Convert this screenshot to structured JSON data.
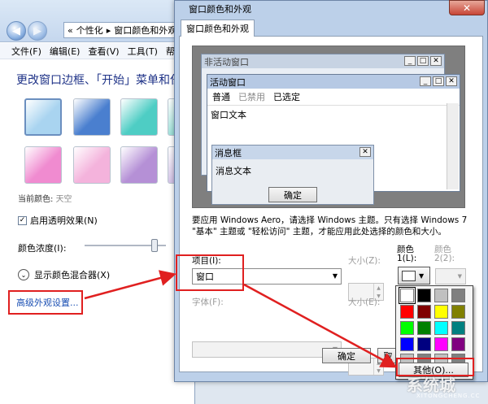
{
  "background_window": {
    "nav": {
      "back": "◀",
      "forward": "▶"
    },
    "address": {
      "prefix": "«",
      "crumb1": "个性化",
      "sep": "▸",
      "crumb2": "窗口颜色和外观"
    },
    "menu": [
      "文件(F)",
      "编辑(E)",
      "查看(V)",
      "工具(T)",
      "帮助"
    ],
    "heading": "更改窗口边框、「开始」菜单和任",
    "swatches": [
      "#a9d4f0",
      "#4a7fcf",
      "#4ecdc4",
      "#9be0d8",
      "#f08bd0",
      "#f4b3dc",
      "#b590d6",
      "#d2c1e6"
    ],
    "current_color_label": "当前颜色:",
    "current_color_value": "天空",
    "transparency_label": "启用透明效果(N)",
    "transparency_check": "✓",
    "intensity_label": "颜色浓度(I):",
    "mixer_label": "显示颜色混合器(X)",
    "mixer_icon": "⌄",
    "advanced_link": "高级外观设置..."
  },
  "dialog": {
    "title": "窗口颜色和外观",
    "close": "✕",
    "tab": "窗口颜色和外观",
    "preview": {
      "inactive_title": "非活动窗口",
      "active_title": "活动窗口",
      "menu_normal": "普通",
      "menu_disabled": "已禁用",
      "menu_selected": "已选定",
      "window_text": "窗口文本",
      "msgbox_title": "消息框",
      "msgbox_text": "消息文本",
      "msgbox_ok": "确定",
      "btn_min": "_",
      "btn_max": "□",
      "btn_close": "✕"
    },
    "description": "要应用 Windows Aero，请选择 Windows 主题。只有选择 Windows 7 \"基本\" 主题或 \"轻松访问\" 主题，才能应用此处选择的颜色和大小。",
    "item_label": "项目(I):",
    "item_value": "窗口",
    "size1_label": "大小(Z):",
    "color1_label": "颜色",
    "color1_sub": "1(L):",
    "color2_label": "颜色",
    "color2_sub": "2(2):",
    "font_label": "字体(F):",
    "size2_label": "大小(E):",
    "ok_button": "确定",
    "cancel_button": "取",
    "arrow_glyph": "▼",
    "palette": {
      "colors": [
        "#ffffff",
        "#000000",
        "#c0c0c0",
        "#808080",
        "#ff0000",
        "#800000",
        "#ffff00",
        "#808000",
        "#00ff00",
        "#008000",
        "#00ffff",
        "#008080",
        "#0000ff",
        "#000080",
        "#ff00ff",
        "#800080",
        "#c0c0c0",
        "#808080",
        "#c0c0c0",
        "#808080"
      ],
      "selected_index": 0,
      "other_button": "其他(O)..."
    }
  },
  "watermark": {
    "main": "系统城",
    "sub": "XITONGCHENG.CC"
  },
  "annotation_color": "#e02020"
}
